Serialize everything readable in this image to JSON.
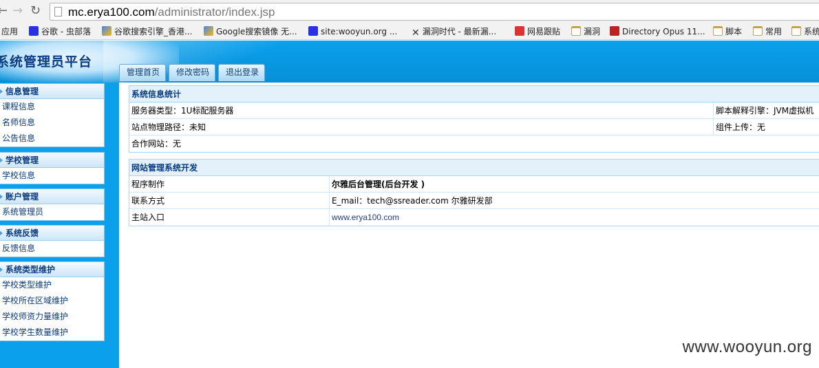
{
  "browser": {
    "url_host": "mc.erya100.com",
    "url_path": "/administrator/index.jsp",
    "bookmarks": [
      {
        "label": "应用",
        "icon": "apps-icon"
      },
      {
        "label": "谷歌 - 虫部落",
        "icon": "baidu-paw-icon"
      },
      {
        "label": "谷歌搜索引擎_香港...",
        "icon": "image-icon"
      },
      {
        "label": "Google搜索镜像 无...",
        "icon": "google-icon"
      },
      {
        "label": "site:wooyun.org ...",
        "icon": "baidu-paw-icon"
      },
      {
        "label": "漏洞时代 - 最新漏...",
        "icon": "x-icon"
      },
      {
        "label": "网易跟贴",
        "icon": "netease-icon"
      },
      {
        "label": "漏洞",
        "icon": "folder-icon"
      },
      {
        "label": "Directory Opus 11...",
        "icon": "dopus-icon"
      },
      {
        "label": "脚本",
        "icon": "folder-icon"
      },
      {
        "label": "常用",
        "icon": "folder-icon"
      },
      {
        "label": "系统",
        "icon": "folder-icon"
      }
    ]
  },
  "header": {
    "title": "系统管理员平台",
    "tabs": [
      "管理首页",
      "修改密码",
      "退出登录"
    ]
  },
  "sidebar": {
    "groups": [
      {
        "title": "信息管理",
        "items": [
          "课程信息",
          "名师信息",
          "公告信息"
        ]
      },
      {
        "title": "学校管理",
        "items": [
          "学校信息"
        ]
      },
      {
        "title": "账户管理",
        "items": [
          "系统管理员"
        ]
      },
      {
        "title": "系统反馈",
        "items": [
          "反馈信息"
        ]
      },
      {
        "title": "系统类型维护",
        "items": [
          "学校类型维护",
          "学校所在区域维护",
          "学校师资力量维护",
          "学校学生数量维护"
        ]
      }
    ]
  },
  "main": {
    "stats": {
      "title": "系统信息统计",
      "server_type": "服务器类型：1U标配服务器",
      "script_engine": "脚本解释引擎：JVM虚拟机",
      "physical_path": "站点物理路径：未知",
      "upload_component": "组件上传：无",
      "partner_site": "合作网站：无"
    },
    "dev": {
      "title": "网站管理系统开发",
      "rows": [
        {
          "label": "程序制作",
          "value": "尔雅后台管理(后台开发 )"
        },
        {
          "label": "联系方式",
          "value": "E_mail：tech@ssreader.com 尔雅研发部"
        },
        {
          "label": "主站入口",
          "value": "www.erya100.com"
        }
      ]
    }
  },
  "watermark": "www.wooyun.org"
}
